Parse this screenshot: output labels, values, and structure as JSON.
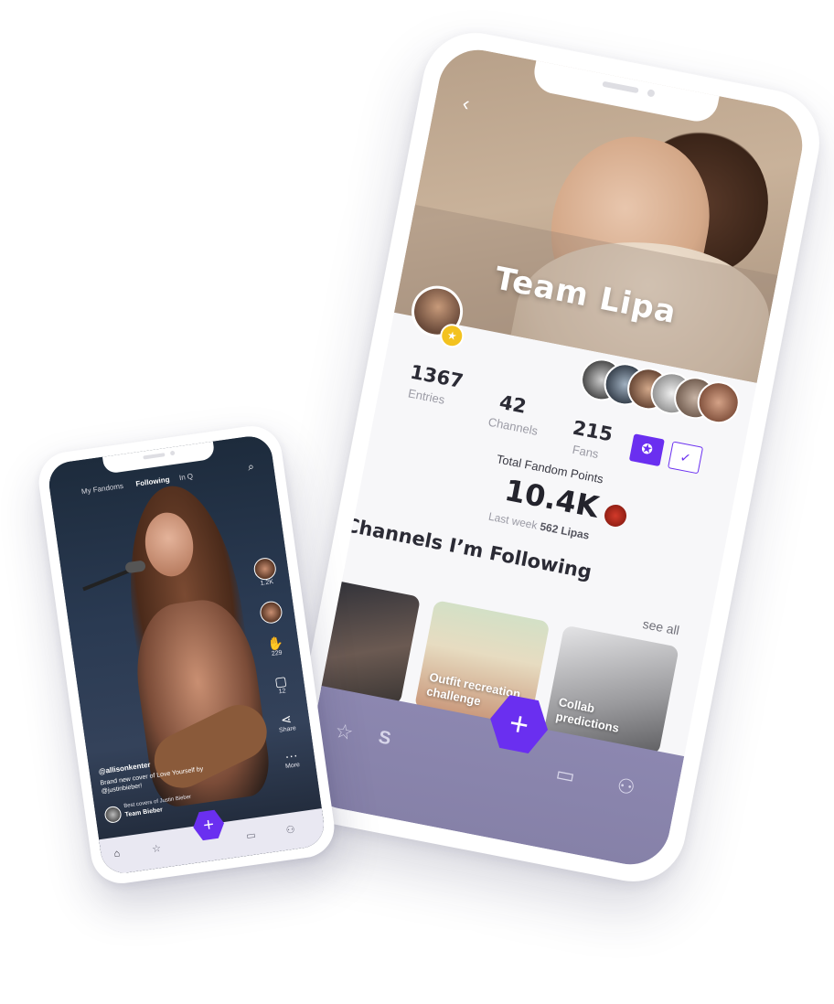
{
  "big_phone": {
    "header": {
      "back_icon": "back-arrow-icon",
      "back_glyph": "‹",
      "title": "Team Lipa"
    },
    "stats": {
      "entries": {
        "value": "1367",
        "label": "Entries"
      },
      "channels": {
        "value": "42",
        "label": "Channels"
      },
      "fans": {
        "value": "215",
        "label": "Fans"
      }
    },
    "actions": {
      "award_glyph": "✪",
      "check_glyph": "✓"
    },
    "points": {
      "label": "Total Fandom Points",
      "value": "10.4K",
      "week_prefix": "Last week",
      "week_value": "562 Lipas"
    },
    "channels_section": {
      "title": "Channels I’m Following",
      "see_all": "see all",
      "cards": [
        {
          "label": ""
        },
        {
          "label": "Outfit recreation challenge"
        },
        {
          "label": "Collab predictions"
        }
      ]
    },
    "nav": {
      "star_glyph": "☆",
      "partial_label": "S",
      "store_glyph": "▭",
      "profile_glyph": "⚇",
      "fab_glyph": "+"
    }
  },
  "small_phone": {
    "tabs": [
      {
        "label": "My Fandoms"
      },
      {
        "label": "Following"
      },
      {
        "label": "In Q"
      }
    ],
    "search_glyph": "⌕",
    "rail": {
      "likes": {
        "count": "1.2K"
      },
      "claps": {
        "glyph": "✋",
        "count": "229"
      },
      "comments": {
        "glyph": "▢",
        "count": "12"
      },
      "share": {
        "glyph": "⋖",
        "label": "Share"
      },
      "more": {
        "glyph": "···",
        "label": "More"
      }
    },
    "caption": {
      "user": "@allisonkenter",
      "description": "Brand new cover of Love Yourself by @justinbieber!"
    },
    "channel": {
      "line1": "Best covers of Justin Bieber",
      "line2": "Team Bieber"
    },
    "nav": {
      "home_glyph": "⌂",
      "star_glyph": "☆",
      "fab_glyph": "+",
      "store_glyph": "▭",
      "profile_glyph": "⚇"
    }
  },
  "colors": {
    "accent": "#6a2ff0",
    "badge": "#f3c21f",
    "nav": "#8a85ad"
  }
}
